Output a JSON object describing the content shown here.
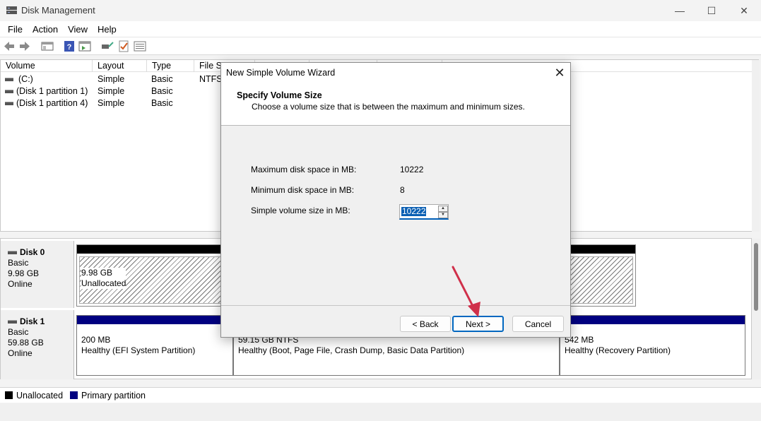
{
  "window": {
    "title": "Disk Management",
    "minimize": "—",
    "maximize": "☐",
    "close": "✕"
  },
  "menu": [
    "File",
    "Action",
    "View",
    "Help"
  ],
  "volume_table": {
    "columns": [
      "Volume",
      "Layout",
      "Type",
      "File Sy"
    ],
    "rows": [
      {
        "volume": "(C:)",
        "layout": "Simple",
        "type": "Basic",
        "fs": "NTFS"
      },
      {
        "volume": "(Disk 1 partition 1)",
        "layout": "Simple",
        "type": "Basic",
        "fs": ""
      },
      {
        "volume": "(Disk 1 partition 4)",
        "layout": "Simple",
        "type": "Basic",
        "fs": ""
      }
    ]
  },
  "disks": [
    {
      "name": "Disk 0",
      "type": "Basic",
      "size": "9.98 GB",
      "status": "Online",
      "partitions": [
        {
          "size": "9.98 GB",
          "label": "Unallocated"
        }
      ]
    },
    {
      "name": "Disk 1",
      "type": "Basic",
      "size": "59.88 GB",
      "status": "Online",
      "partitions": [
        {
          "size": "200 MB",
          "label": "Healthy (EFI System Partition)"
        },
        {
          "size": "59.15 GB NTFS",
          "label": "Healthy (Boot, Page File, Crash Dump, Basic Data Partition)"
        },
        {
          "size": "542 MB",
          "label": "Healthy (Recovery Partition)"
        }
      ]
    }
  ],
  "legend": {
    "items": [
      {
        "label": "Unallocated",
        "color": "#000000"
      },
      {
        "label": "Primary partition",
        "color": "#000080"
      }
    ]
  },
  "wizard": {
    "title": "New Simple Volume Wizard",
    "heading": "Specify Volume Size",
    "subheading": "Choose a volume size that is between the maximum and minimum sizes.",
    "max_label": "Maximum disk space in MB:",
    "max_value": "10222",
    "min_label": "Minimum disk space in MB:",
    "min_value": "8",
    "size_label": "Simple volume size in MB:",
    "size_value": "10222",
    "back": "< Back",
    "next": "Next >",
    "cancel": "Cancel"
  },
  "colors": {
    "accent": "#0067c0",
    "arrow": "#d0304a",
    "primary_partition": "#000080"
  }
}
